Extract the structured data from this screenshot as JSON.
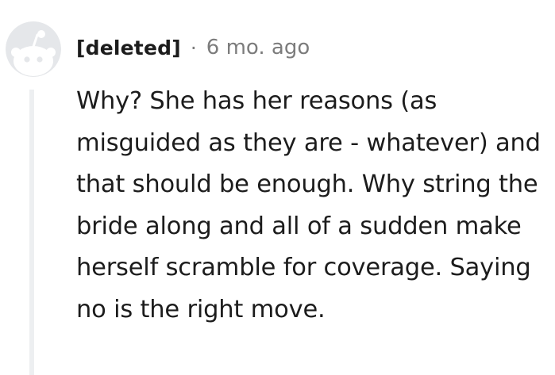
{
  "comment": {
    "author": "[deleted]",
    "separator": "·",
    "timestamp": "6 mo. ago",
    "body": "Why? She has her reasons (as misguided as they are - whatever) and that should be enough. Why string the bride along and all of a sudden make herself scramble for coverage. Saying no is the right move.",
    "avatar_icon": "snoo-avatar-icon",
    "colors": {
      "avatar_bg": "#e5e7ea",
      "avatar_fg": "#ffffff",
      "thread_line": "#edeff1",
      "meta_text": "#7c7c7c",
      "body_text": "#1c1c1c"
    }
  }
}
